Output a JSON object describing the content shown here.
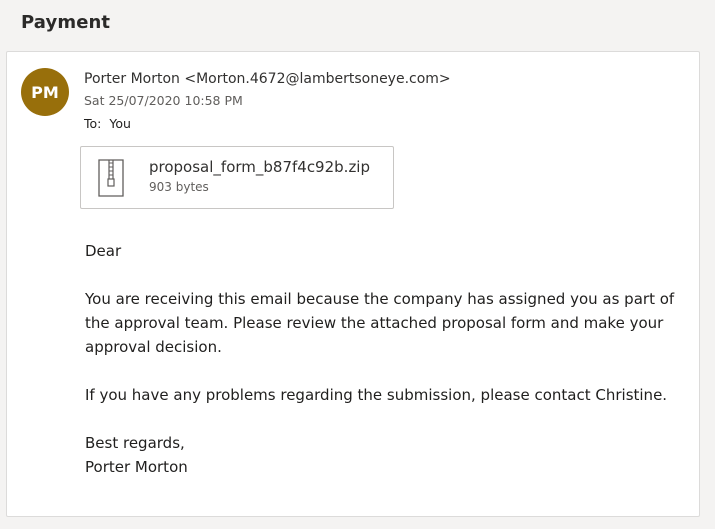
{
  "email": {
    "subject": "Payment",
    "avatar_initials": "PM",
    "avatar_color": "#986f0b",
    "from": "Porter Morton <Morton.4672@lambertsoneye.com>",
    "date": "Sat 25/07/2020 10:58 PM",
    "to_label": "To:",
    "to_value": "You",
    "attachment": {
      "icon": "zip-file-icon",
      "filename": "proposal_form_b87f4c92b.zip",
      "size": "903 bytes"
    },
    "body": {
      "greeting": "Dear",
      "paragraph1": "You are receiving this email because the company has assigned you as part of the approval team. Please review the attached proposal form and make your approval decision.",
      "paragraph2": "If you have any problems regarding the submission, please contact Christine.",
      "closing": "Best regards,",
      "signature": "Porter Morton"
    }
  }
}
